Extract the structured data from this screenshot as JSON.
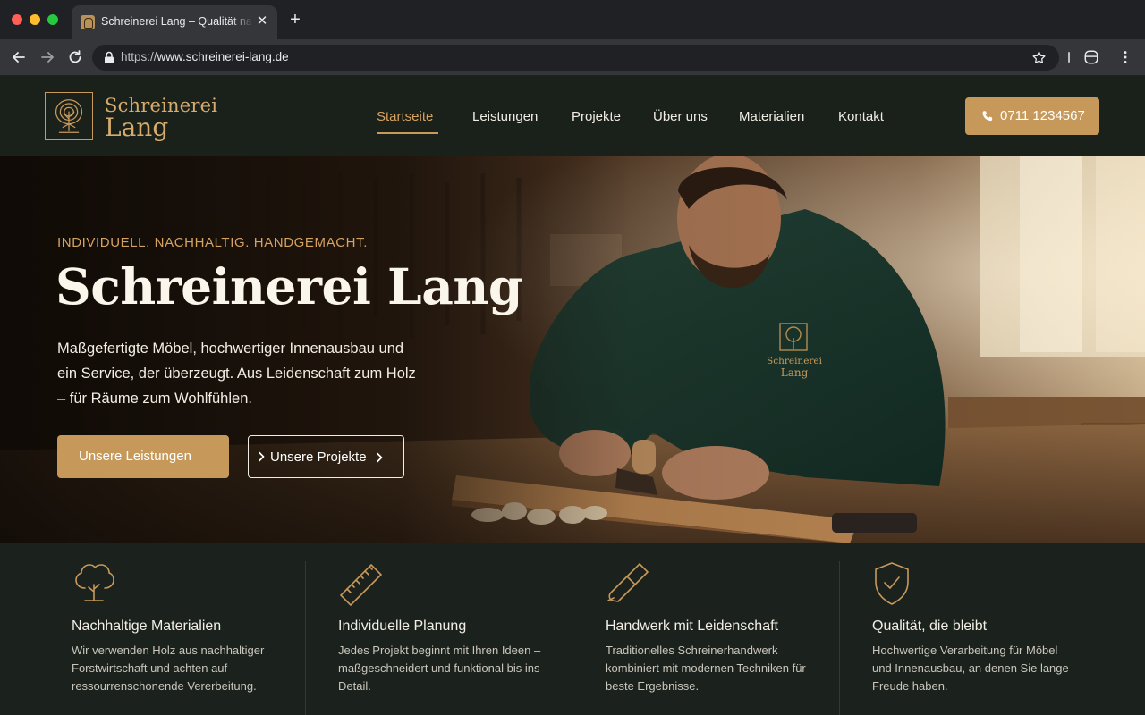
{
  "browser": {
    "tab_title": "Schreinerei Lang – Qualität nach Maß",
    "url_scheme": "https://",
    "url_host": "www.schreinerei-lang.de"
  },
  "site": {
    "logo_line1": "Schreinerei",
    "logo_line2": "Lang",
    "nav": [
      {
        "label": "Startseite"
      },
      {
        "label": "Leistungen"
      },
      {
        "label": "Projekte"
      },
      {
        "label": "Über uns"
      },
      {
        "label": "Materialien"
      },
      {
        "label": "Kontakt"
      }
    ],
    "phone": "0711 1234567"
  },
  "hero": {
    "eyebrow": "INDIVIDUELL. NACHHALTIG. HANDGEMACHT.",
    "title": "Schreinerei Lang",
    "text": "Maßgefertigte Möbel, hochwertiger Innenausbau und ein Service, der überzeugt. Aus Leidenschaft zum Holz – für Räume zum Wohlfühlen.",
    "primary_button": "Unsere Leistungen",
    "secondary_button": "Unsere Projekte",
    "sweater_logo_line1": "Schreinerei",
    "sweater_logo_line2": "Lang"
  },
  "features": [
    {
      "icon": "tree-icon",
      "title": "Nachhaltige Materialien",
      "text": "Wir verwenden Holz aus nachhaltiger Forstwirtschaft und achten auf ressourrenschonende Vererbeitung."
    },
    {
      "icon": "ruler-icon",
      "title": "Individuelle Planung",
      "text": "Jedes Projekt beginnt mit Ihren Ideen – maßgeschneidert und funktional bis ins Detail."
    },
    {
      "icon": "plane-tool-icon",
      "title": "Handwerk mit Leidenschaft",
      "text": "Traditionelles Schreinerhandwerk kombiniert mit modernen Techniken für beste Ergebnisse."
    },
    {
      "icon": "shield-check-icon",
      "title": "Qualität, die bleibt",
      "text": "Hochwertige Verarbeitung für Möbel und Innenausbau, an denen Sie lange Freude haben."
    }
  ],
  "colors": {
    "accent": "#c6995b",
    "header_bg": "#1a211b",
    "features_bg": "#1b211c"
  }
}
